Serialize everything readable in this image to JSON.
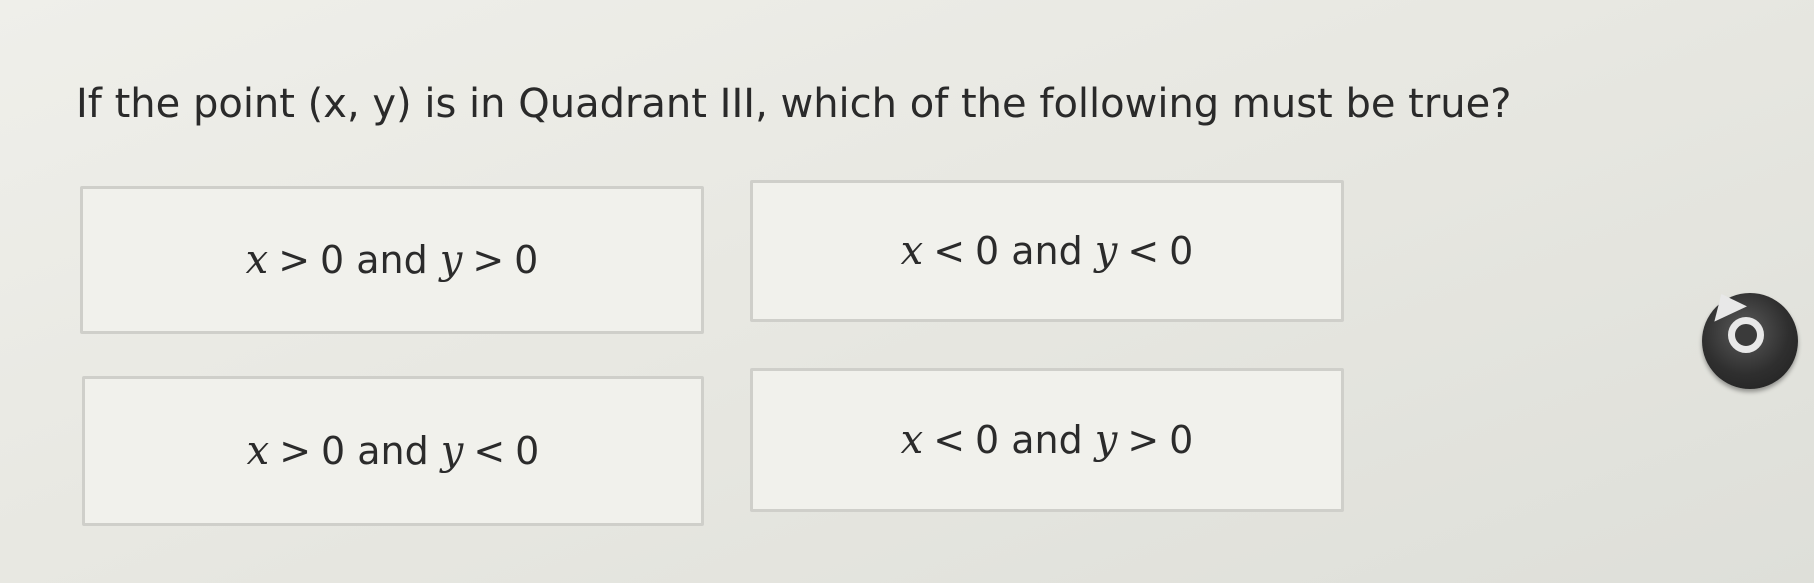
{
  "question": {
    "text": "If the point (x, y) is in Quadrant III, which of the following must be true?"
  },
  "answers": [
    {
      "x_var": "x",
      "x_op": ">",
      "x_val": "0",
      "conj": "and",
      "y_var": "y",
      "y_op": ">",
      "y_val": "0"
    },
    {
      "x_var": "x",
      "x_op": "<",
      "x_val": "0",
      "conj": "and",
      "y_var": "y",
      "y_op": "<",
      "y_val": "0"
    },
    {
      "x_var": "x",
      "x_op": ">",
      "x_val": "0",
      "conj": "and",
      "y_var": "y",
      "y_op": "<",
      "y_val": "0"
    },
    {
      "x_var": "x",
      "x_op": "<",
      "x_val": "0",
      "conj": "and",
      "y_var": "y",
      "y_op": ">",
      "y_val": "0"
    }
  ],
  "cursor": {
    "icon": "busy-dial-icon"
  },
  "colors": {
    "background": "#e8e8e2",
    "card_background": "#f1f1ec",
    "card_border": "#cfcfca",
    "text": "#2b2b2b"
  }
}
